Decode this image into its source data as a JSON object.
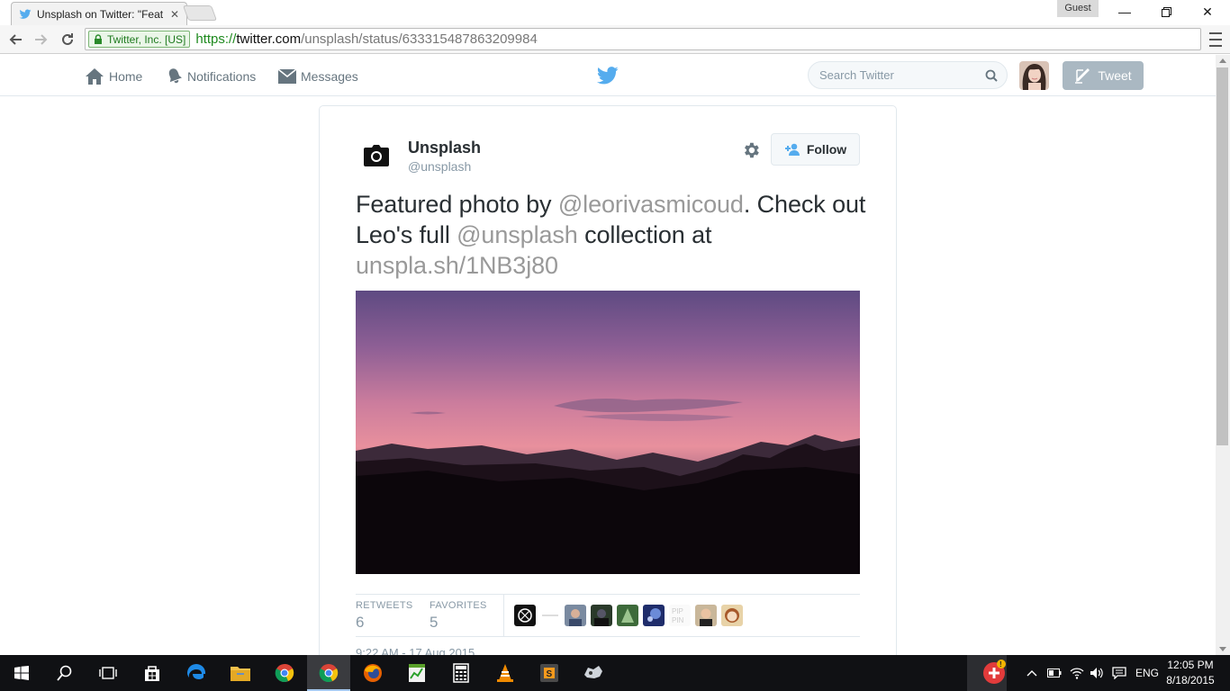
{
  "browser": {
    "tab_title": "Unsplash on Twitter: \"Feat",
    "profile_label": "Guest",
    "ev_label": "Twitter, Inc. [US]",
    "url_scheme": "https://",
    "url_host": "twitter.com",
    "url_path": "/unsplash/status/633315487863209984"
  },
  "twitter_nav": {
    "home": "Home",
    "notifications": "Notifications",
    "messages": "Messages",
    "search_placeholder": "Search Twitter",
    "tweet_button": "Tweet"
  },
  "tweet": {
    "fullname": "Unsplash",
    "username": "@unsplash",
    "follow_label": "Follow",
    "text_1": "Featured photo by ",
    "mention_1": "@leorivasmicoud",
    "text_2": ". Check out Leo's full ",
    "mention_2": "@unsplash",
    "text_3": " collection at ",
    "link": "unspla.sh/1NB3j80",
    "retweets_label": "RETWEETS",
    "retweets_count": "6",
    "favorites_label": "FAVORITES",
    "favorites_count": "5",
    "timestamp": "9:22 AM - 17 Aug 2015"
  },
  "taskbar": {
    "language": "ENG",
    "time": "12:05 PM",
    "date": "8/18/2015"
  },
  "colors": {
    "twitter_blue": "#55acee",
    "text_dark": "#292f33",
    "text_muted": "#8899a6",
    "ev_green": "#1e8a1e",
    "taskbar_bg": "#101114"
  },
  "icons": [
    "twitter-bird-icon",
    "home-icon",
    "bell-icon",
    "envelope-icon",
    "search-icon",
    "compose-icon",
    "camera-icon",
    "gear-icon",
    "follow-person-icon",
    "windows-start-icon",
    "cortana-search-icon",
    "task-view-icon",
    "store-icon",
    "edge-icon",
    "file-explorer-icon",
    "chrome-icon",
    "firefox-icon",
    "calculator-icon",
    "vlc-icon",
    "sublime-icon",
    "tray-up-arrow-icon",
    "battery-icon",
    "wifi-icon",
    "volume-icon",
    "action-center-icon"
  ]
}
